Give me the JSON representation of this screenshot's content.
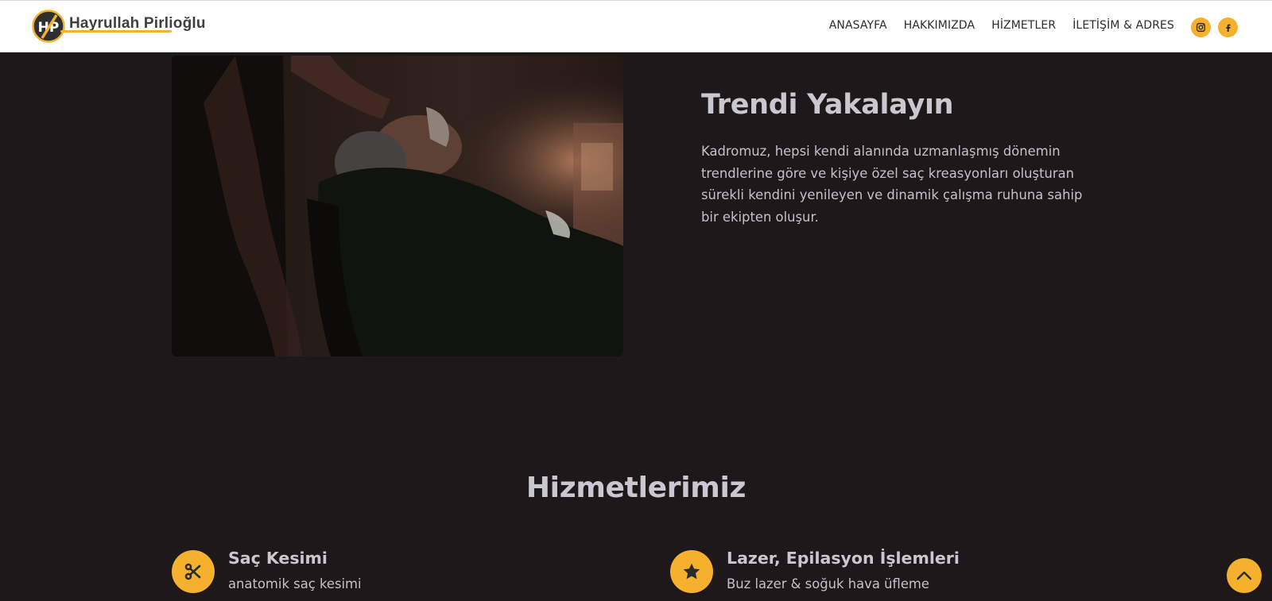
{
  "brand": {
    "name": "Hayrullah Pirlioğlu"
  },
  "nav": {
    "items": [
      {
        "label": "ANASAYFA"
      },
      {
        "label": "HAKKIMIZDA"
      },
      {
        "label": "HİZMETLER"
      },
      {
        "label": "İLETİŞİM & ADRES"
      }
    ]
  },
  "social": {
    "icons": [
      "instagram-icon",
      "facebook-icon"
    ]
  },
  "hero": {
    "title": "Trendi Yakalayın",
    "description": "Kadromuz, hepsi kendi alanında uzmanlaşmış dönemin trendlerine göre ve kişiye özel saç kreasyonları oluşturan sürekli kendini yenileyen ve dinamik çalışma ruhuna sahip bir ekipten oluşur."
  },
  "services": {
    "title": "Hizmetlerimiz",
    "items": [
      {
        "icon": "scissors-icon",
        "title": "Saç Kesimi",
        "description": "anatomik saç kesimi"
      },
      {
        "icon": "star-icon",
        "title": "Lazer, Epilasyon İşlemleri",
        "description": "Buz lazer & soğuk hava üfleme"
      }
    ]
  },
  "colors": {
    "accent": "#f5b12e",
    "background": "#1e181b",
    "header": "#ffffff"
  }
}
